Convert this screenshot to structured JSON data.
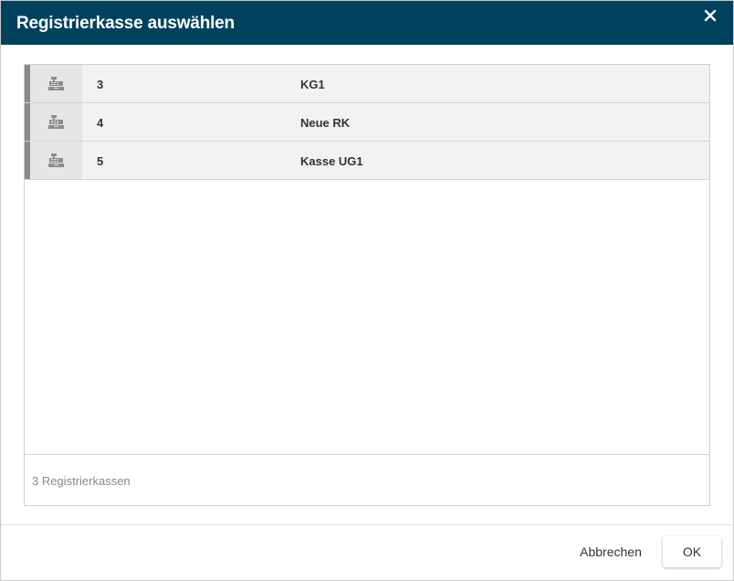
{
  "dialog": {
    "title": "Registrierkasse auswählen",
    "close_icon": "close-icon"
  },
  "registers": [
    {
      "icon": "cash-register-icon",
      "number": "3",
      "name": "KG1"
    },
    {
      "icon": "cash-register-icon",
      "number": "4",
      "name": "Neue RK"
    },
    {
      "icon": "cash-register-icon",
      "number": "5",
      "name": "Kasse UG1"
    }
  ],
  "list_footer": {
    "count_text": "3 Registrierkassen"
  },
  "buttons": {
    "cancel_label": "Abbrechen",
    "ok_label": "OK"
  },
  "colors": {
    "titlebar": "#00425e",
    "row_background": "#f2f2f2",
    "row_accent_bar": "#8a8a8a"
  }
}
